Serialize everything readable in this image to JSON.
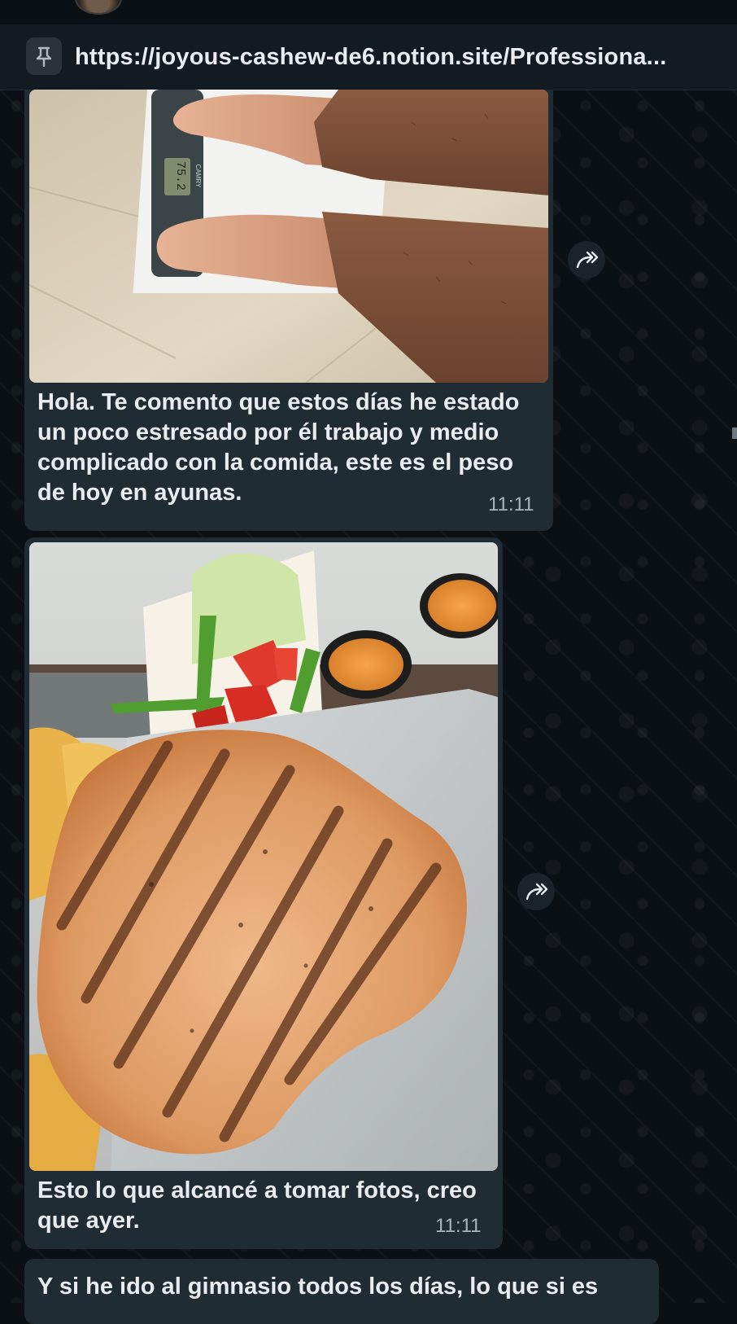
{
  "pinned": {
    "url": "https://joyous-cashew-de6.notion.site/Professiona..."
  },
  "messages": [
    {
      "type": "image",
      "image_desc": "scale-photo",
      "text": "Hola. Te comento que estos días he estado un poco estresado por él trabajo y medio complicado con la comida, este es el peso de hoy en ayunas.",
      "time": "11:11",
      "scale_reading": "75.2",
      "scale_brand": "CAMRY"
    },
    {
      "type": "image",
      "image_desc": "food-photo",
      "text": "Esto lo que alcancé a tomar fotos, creo que ayer.",
      "time": "11:11"
    },
    {
      "type": "text",
      "text": "Y si he ido al gimnasio todos los días, lo que si es"
    }
  ],
  "colors": {
    "bubble": "#202c33",
    "background": "#0b1014",
    "pinned_bar": "#111b21"
  },
  "icons": [
    "pin-icon",
    "forward-icon"
  ]
}
